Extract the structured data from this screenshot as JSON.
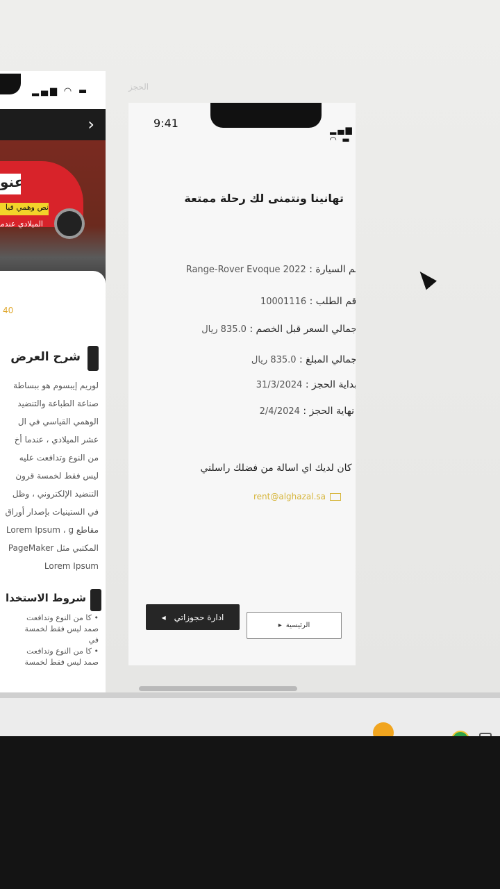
{
  "canvas": {
    "frame_label": "الحجز"
  },
  "left_frame": {
    "hero_title": "عنو",
    "hero_sub1": "نص وهمي فيا",
    "hero_sub2": "الميلادي عندما",
    "count": "40",
    "offer_section_title": "شرح العرض",
    "offer_body": [
      "لوريم إيبسوم هو ببساطة",
      "صناعة الطباعة والتنضيد",
      "الوهمي القياسي في ال",
      "عشر الميلادي ، عندما أخ",
      "من النوع وتدافعت عليه",
      "ليس فقط لخمسة قرون",
      "التنضيد الإلكتروني ، وظل",
      "في الستينيات بإصدار أوراق",
      "مقاطع Lorem Ipsum ، g",
      "المكتبي مثل PageMaker",
      "Lorem Ipsum"
    ],
    "terms_section_title": "شروط الاستخدا",
    "terms_items": [
      "• كا من النوع وتدافعت",
      "صمد ليس فقط لخمسة",
      "في",
      "• كا من النوع وتدافعت",
      "صمد ليس فقط لخمسة"
    ]
  },
  "phone": {
    "time": "9:41",
    "status_icons": "▂▄▆ ◠ ▬",
    "title": "تهانينا ونتمنى لك رحلة ممتعة",
    "details": [
      {
        "label": "اسم السيارة :",
        "value": "Range-Rover Evoque 2022"
      },
      {
        "label": "رقم الطلب :",
        "value": "10001116"
      },
      {
        "label": "اجمالي السعر قبل الخصم :",
        "value": "835.0 ريال"
      },
      {
        "label": "اجمالي المبلغ :",
        "value": "835.0 ريال"
      },
      {
        "label": "بداية الحجز :",
        "value": "31/3/2024"
      },
      {
        "label": "نهاية الحجز :",
        "value": "2/4/2024"
      }
    ],
    "contact_text": "اذا كان لديك اي اسالة من فضلك راسلني",
    "email": "rent@alghazal.sa",
    "manage_button": "ادارة حجوزاتي",
    "home_button": "الرئيسية",
    "arrow_glyph": "◂",
    "arrow_glyph_home": "▸"
  },
  "colors": {
    "accent": "#d6b53a",
    "dark_button": "#262626",
    "hero_red": "#d8232a"
  }
}
